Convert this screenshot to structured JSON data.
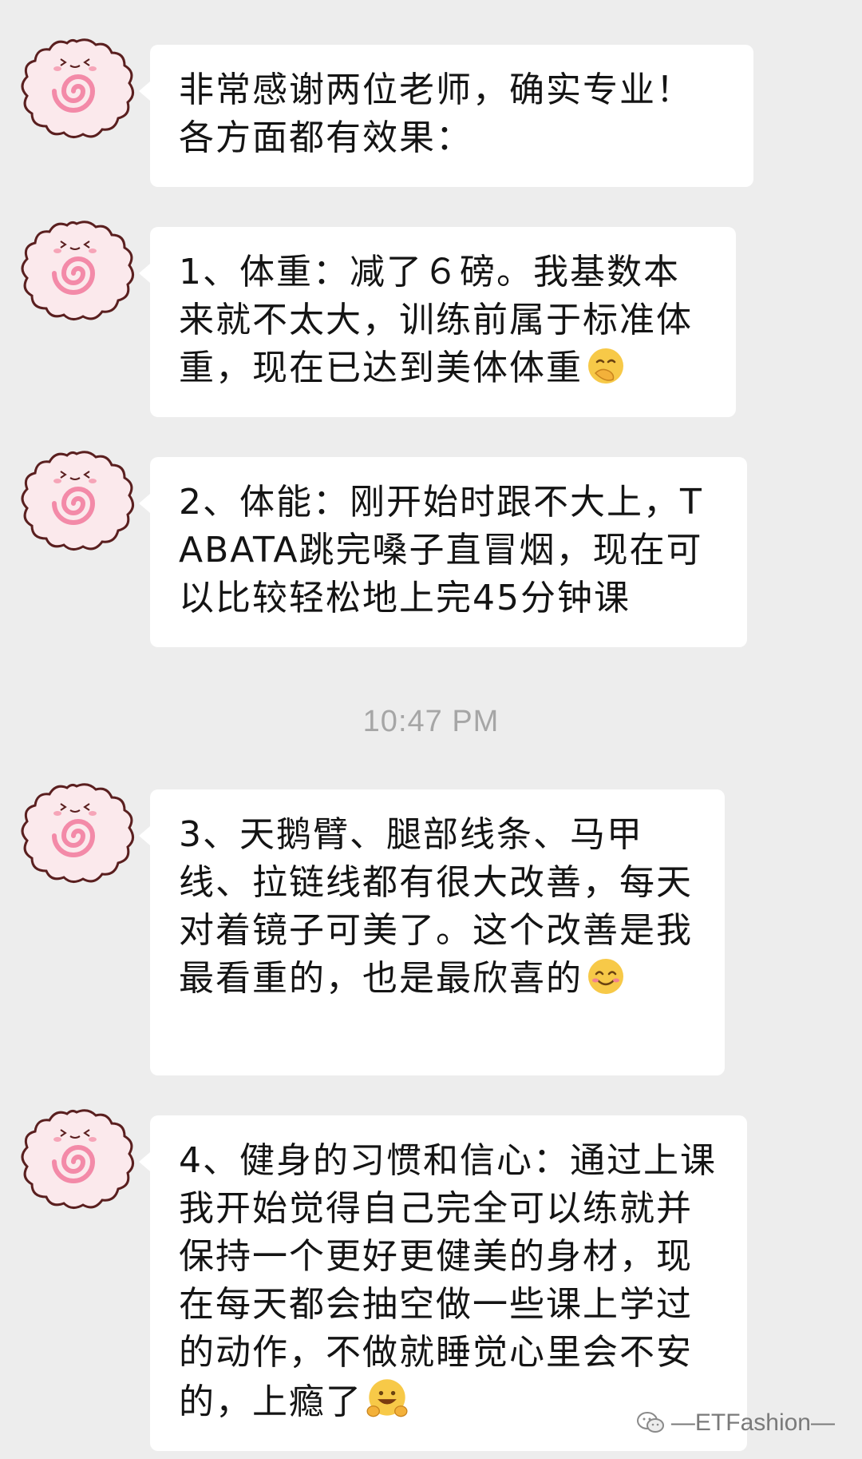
{
  "timestamp": "10:47 PM",
  "messages": [
    {
      "text": "非常感谢两位老师，确实专业！各方面都有效果：",
      "emoji": ""
    },
    {
      "text": "1、体重：减了６磅。我基数本来就不太大，训练前属于标准体重，现在已达到美体体重",
      "emoji": "face-with-hand-over-mouth"
    },
    {
      "text": "2、体能：刚开始时跟不大上，TABATA跳完嗓子直冒烟，现在可以比较轻松地上完45分钟课",
      "emoji": ""
    },
    {
      "text": "3、天鹅臂、腿部线条、马甲线、拉链线都有很大改善，每天对着镜子可美了。这个改善是我最看重的，也是最欣喜的",
      "emoji": "smiling-face-with-smiling-eyes"
    },
    {
      "text": "4、健身的习惯和信心：通过上课我开始觉得自己完全可以练就并保持一个更好更健美的身材，现在每天都会抽空做一些课上学过的动作，不做就睡觉心里会不安的，上瘾了",
      "emoji": "grinning-face-with-hands"
    }
  ],
  "avatar": {
    "icon": "pink-swirl-cookie-avatar",
    "colors": {
      "fill": "#fbe9ec",
      "outline": "#5a1f1f",
      "swirl": "#f38aa8"
    }
  },
  "watermark": {
    "icon": "wechat-official-account-icon",
    "text": "—ETFashion—"
  },
  "colors": {
    "background": "#ededed",
    "bubble": "#ffffff",
    "text": "#141414",
    "timestamp": "#a6a6a6"
  }
}
